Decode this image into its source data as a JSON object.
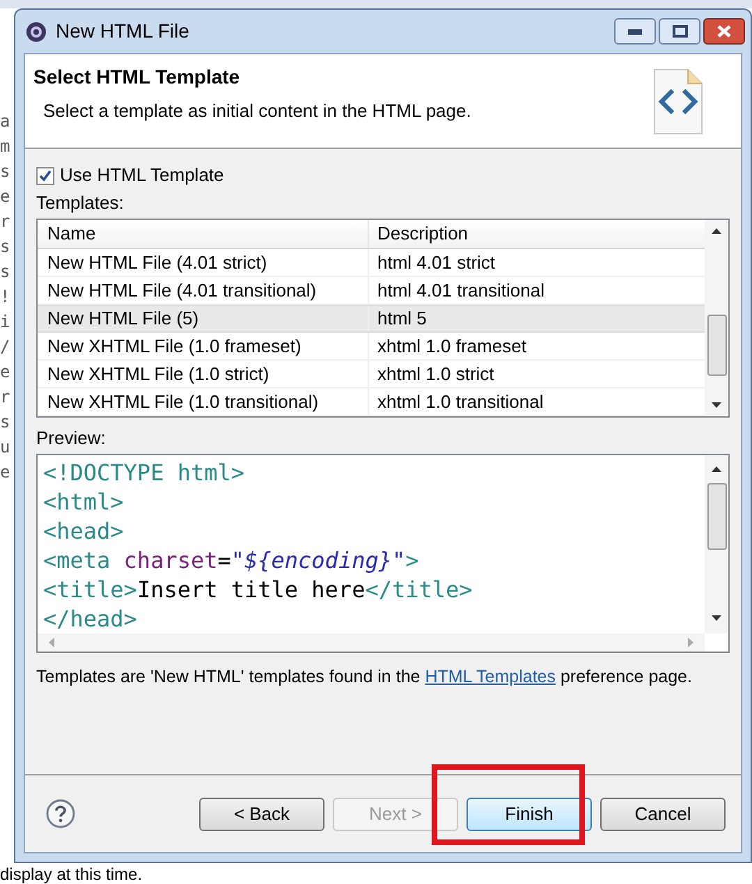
{
  "background_editor": {
    "letters": [
      "a",
      "m",
      "s",
      "e",
      "r",
      "s",
      "s",
      "!",
      "i",
      "/",
      "e",
      "r",
      "s",
      "u",
      "e"
    ],
    "status_text": "display at this time."
  },
  "window": {
    "title": "New HTML File"
  },
  "header": {
    "title": "Select HTML Template",
    "description": "Select a template as initial content in the HTML page."
  },
  "use_template": {
    "label": "Use HTML Template",
    "checked": true
  },
  "templates": {
    "label": "Templates:",
    "columns": [
      "Name",
      "Description"
    ],
    "rows": [
      {
        "name": "New HTML File (4.01 strict)",
        "description": "html 4.01 strict",
        "selected": false
      },
      {
        "name": "New HTML File (4.01 transitional)",
        "description": "html 4.01 transitional",
        "selected": false
      },
      {
        "name": "New HTML File (5)",
        "description": "html 5",
        "selected": true
      },
      {
        "name": "New XHTML File (1.0 frameset)",
        "description": "xhtml 1.0 frameset",
        "selected": false
      },
      {
        "name": "New XHTML File (1.0 strict)",
        "description": "xhtml 1.0 strict",
        "selected": false
      },
      {
        "name": "New XHTML File (1.0 transitional)",
        "description": "xhtml 1.0 transitional",
        "selected": false
      }
    ]
  },
  "preview": {
    "label": "Preview:",
    "lines": [
      [
        {
          "kind": "tag",
          "text": "<!DOCTYPE html>"
        }
      ],
      [
        {
          "kind": "tag",
          "text": "<html>"
        }
      ],
      [
        {
          "kind": "tag",
          "text": "<head>"
        }
      ],
      [
        {
          "kind": "tag",
          "text": "<meta "
        },
        {
          "kind": "attr",
          "text": "charset"
        },
        {
          "kind": "text",
          "text": "="
        },
        {
          "kind": "value",
          "text": "\"${encoding}\""
        },
        {
          "kind": "tag",
          "text": ">"
        }
      ],
      [
        {
          "kind": "tag",
          "text": "<title>"
        },
        {
          "kind": "text",
          "text": "Insert title here"
        },
        {
          "kind": "tag",
          "text": "</title>"
        }
      ],
      [
        {
          "kind": "tag",
          "text": "</head>"
        }
      ]
    ]
  },
  "footer_note": {
    "before": "Templates are 'New HTML' templates found in the ",
    "link": "HTML Templates",
    "after": " preference page."
  },
  "buttons": [
    {
      "label": "< Back",
      "disabled": false,
      "default": false,
      "highlighted": false
    },
    {
      "label": "Next >",
      "disabled": true,
      "default": false,
      "highlighted": false
    },
    {
      "label": "Finish",
      "disabled": false,
      "default": true,
      "highlighted": true
    },
    {
      "label": "Cancel",
      "disabled": false,
      "default": false,
      "highlighted": false
    }
  ]
}
